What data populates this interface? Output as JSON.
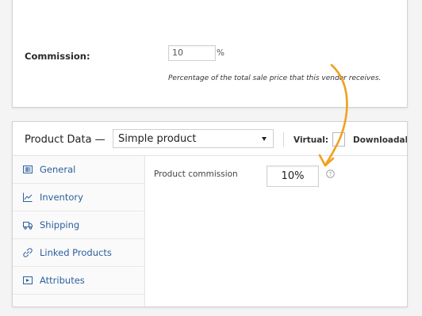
{
  "settings": {
    "commission_label": "Commission:",
    "commission_value": "10",
    "commission_unit": "%",
    "commission_description": "Percentage of the total sale price that this vendor receives."
  },
  "product_data": {
    "title": "Product Data —",
    "product_type": "Simple product",
    "virtual_label": "Virtual:",
    "downloadable_label": "Downloadal",
    "tabs": [
      {
        "label": "General",
        "icon": "general-icon"
      },
      {
        "label": "Inventory",
        "icon": "inventory-icon"
      },
      {
        "label": "Shipping",
        "icon": "shipping-icon"
      },
      {
        "label": "Linked Products",
        "icon": "link-icon"
      },
      {
        "label": "Attributes",
        "icon": "attributes-icon"
      }
    ],
    "product_commission_label": "Product commission",
    "product_commission_value": "10%"
  },
  "colors": {
    "arrow": "#f0a020",
    "link": "#2c5f9e"
  }
}
